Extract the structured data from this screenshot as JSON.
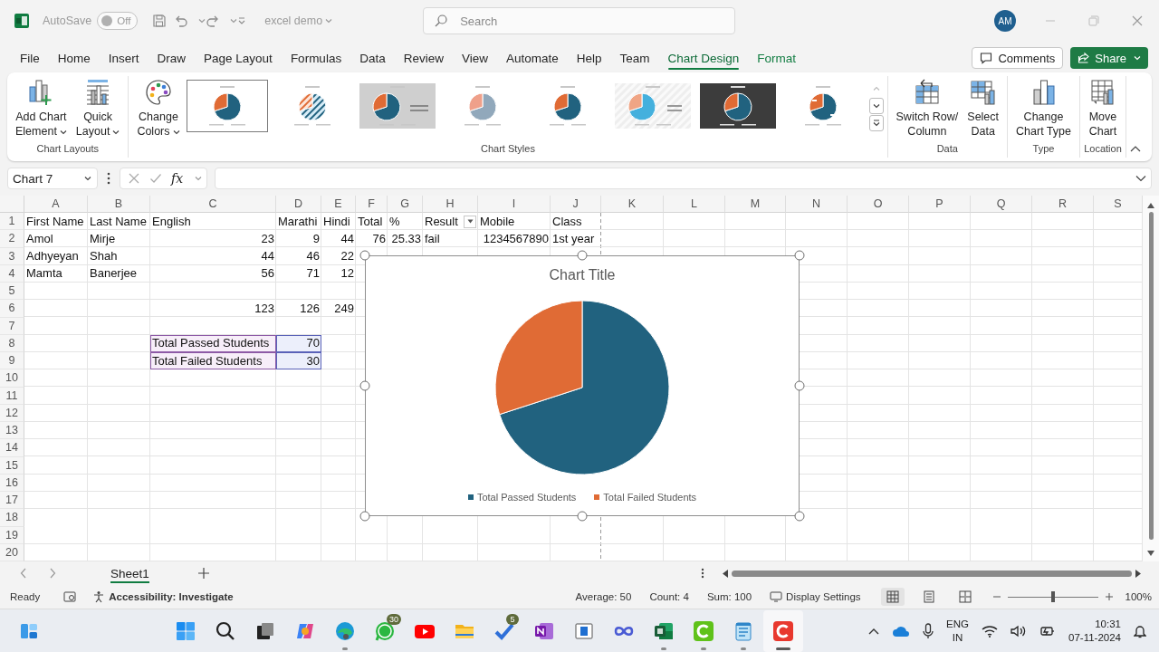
{
  "title_bar": {
    "autosave_label": "AutoSave",
    "autosave": {
      "on": false,
      "label": "Off"
    },
    "document": "excel demo",
    "search": {
      "placeholder": "Search"
    },
    "avatar": "AM"
  },
  "tabs": [
    {
      "label": "File",
      "selected": false,
      "contextual": false
    },
    {
      "label": "Home",
      "selected": false,
      "contextual": false
    },
    {
      "label": "Insert",
      "selected": false,
      "contextual": false
    },
    {
      "label": "Draw",
      "selected": false,
      "contextual": false
    },
    {
      "label": "Page Layout",
      "selected": false,
      "contextual": false
    },
    {
      "label": "Formulas",
      "selected": false,
      "contextual": false
    },
    {
      "label": "Data",
      "selected": false,
      "contextual": false
    },
    {
      "label": "Review",
      "selected": false,
      "contextual": false
    },
    {
      "label": "View",
      "selected": false,
      "contextual": false
    },
    {
      "label": "Automate",
      "selected": false,
      "contextual": false
    },
    {
      "label": "Help",
      "selected": false,
      "contextual": false
    },
    {
      "label": "Team",
      "selected": false,
      "contextual": false
    },
    {
      "label": "Chart Design",
      "selected": true,
      "contextual": true
    },
    {
      "label": "Format",
      "selected": false,
      "contextual": true
    }
  ],
  "comments_button": "Comments",
  "share_button": "Share",
  "ribbon": {
    "groups": [
      {
        "label": "Chart Layouts",
        "buttons": [
          {
            "lines": [
              "Add Chart",
              "Element"
            ],
            "dropdown": true
          },
          {
            "lines": [
              "Quick",
              "Layout"
            ],
            "dropdown": true
          }
        ]
      },
      {
        "label": "Chart Styles",
        "buttons": [
          {
            "lines": [
              "Change",
              "Colors"
            ],
            "dropdown": true
          }
        ],
        "gallery": [
          {
            "kind": "plain",
            "selected": true
          },
          {
            "kind": "hatched",
            "selected": false
          },
          {
            "kind": "shaded",
            "selected": false
          },
          {
            "kind": "soft",
            "selected": false
          },
          {
            "kind": "plain",
            "selected": false
          },
          {
            "kind": "striped",
            "selected": false
          },
          {
            "kind": "dark",
            "selected": false
          },
          {
            "kind": "labeled",
            "selected": false
          }
        ]
      },
      {
        "label": "Data",
        "buttons": [
          {
            "lines": [
              "Switch Row/",
              "Column"
            ],
            "dropdown": false
          },
          {
            "lines": [
              "Select",
              "Data"
            ],
            "dropdown": false
          }
        ]
      },
      {
        "label": "Type",
        "buttons": [
          {
            "lines": [
              "Change",
              "Chart Type"
            ],
            "dropdown": false
          }
        ]
      },
      {
        "label": "Location",
        "buttons": [
          {
            "lines": [
              "Move",
              "Chart"
            ],
            "dropdown": false
          }
        ]
      }
    ]
  },
  "formula_bar": {
    "name_box": "Chart 7",
    "function_label": "fx"
  },
  "sheet": {
    "columns": [
      "A",
      "B",
      "C",
      "D",
      "E",
      "F",
      "G",
      "H",
      "I",
      "J",
      "K",
      "L",
      "M",
      "N",
      "O",
      "P",
      "Q",
      "R",
      "S"
    ],
    "rows": [
      {
        "header": "1",
        "cells": [
          {
            "text": "First Name",
            "kind": "text"
          },
          {
            "text": "Last Name",
            "kind": "text"
          },
          {
            "text": "English",
            "kind": "text"
          },
          {
            "text": "Marathi",
            "kind": "text"
          },
          {
            "text": "Hindi",
            "kind": "text"
          },
          {
            "text": "Total",
            "kind": "text"
          },
          {
            "text": "%",
            "kind": "text"
          },
          {
            "text": "Result",
            "kind": "text",
            "filter": true
          },
          {
            "text": "Mobile",
            "kind": "text"
          },
          {
            "text": "Class",
            "kind": "text"
          }
        ]
      },
      {
        "header": "2",
        "cells": [
          {
            "text": "Amol",
            "kind": "text"
          },
          {
            "text": "Mirje",
            "kind": "text"
          },
          {
            "text": "23",
            "kind": "number"
          },
          {
            "text": "9",
            "kind": "number"
          },
          {
            "text": "44",
            "kind": "number"
          },
          {
            "text": "76",
            "kind": "number"
          },
          {
            "text": "25.33",
            "kind": "number"
          },
          {
            "text": "fail",
            "kind": "text"
          },
          {
            "text": "1234567890",
            "kind": "number"
          },
          {
            "text": "1st year",
            "kind": "text"
          }
        ]
      },
      {
        "header": "3",
        "cells": [
          {
            "text": "Adhyeyan",
            "kind": "text"
          },
          {
            "text": "Shah",
            "kind": "text"
          },
          {
            "text": "44",
            "kind": "number"
          },
          {
            "text": "46",
            "kind": "number"
          },
          {
            "text": "22",
            "kind": "number"
          }
        ]
      },
      {
        "header": "4",
        "cells": [
          {
            "text": "Mamta",
            "kind": "text"
          },
          {
            "text": "Banerjee",
            "kind": "text"
          },
          {
            "text": "56",
            "kind": "number"
          },
          {
            "text": "71",
            "kind": "number"
          },
          {
            "text": "12",
            "kind": "number"
          }
        ]
      },
      {
        "header": "5"
      },
      {
        "header": "6",
        "cells": [
          {
            "kind": "blank"
          },
          {
            "kind": "blank"
          },
          {
            "text": "123",
            "kind": "number"
          },
          {
            "text": "126",
            "kind": "number"
          },
          {
            "text": "249",
            "kind": "number"
          }
        ]
      },
      {
        "header": "7"
      },
      {
        "header": "8",
        "cells": [
          {
            "kind": "blank"
          },
          {
            "kind": "blank"
          },
          {
            "text": "Total Passed Students",
            "kind": "text",
            "highlighted": true
          },
          {
            "text": "70",
            "kind": "number",
            "highlighted": true
          }
        ]
      },
      {
        "header": "9",
        "cells": [
          {
            "kind": "blank"
          },
          {
            "kind": "blank"
          },
          {
            "text": "Total Failed Students",
            "kind": "text",
            "highlighted": true
          },
          {
            "text": "30",
            "kind": "number",
            "highlighted": true
          }
        ]
      },
      {
        "header": "10"
      },
      {
        "header": "11"
      },
      {
        "header": "12"
      },
      {
        "header": "13"
      },
      {
        "header": "14"
      },
      {
        "header": "15"
      },
      {
        "header": "16"
      },
      {
        "header": "17"
      },
      {
        "header": "18"
      },
      {
        "header": "19"
      },
      {
        "header": "20"
      }
    ]
  },
  "chart": {
    "chart_data": {
      "type": "pie",
      "title": "Chart Title",
      "categories": [
        "Total Passed Students",
        "Total Failed Students"
      ],
      "values": [
        70,
        30
      ]
    },
    "legend": [
      {
        "color": "#21627f"
      },
      {
        "color": "#e06b35"
      }
    ]
  },
  "sheet_tabs": [
    {
      "label": "Sheet1",
      "selected": true
    }
  ],
  "status_bar": {
    "ready": "Ready",
    "accessibility": "Accessibility: Investigate",
    "average": "Average: 50",
    "count": "Count: 4",
    "sum": "Sum: 100",
    "display_settings": "Display Settings",
    "views": [
      {
        "selected": true
      },
      {
        "selected": false
      },
      {
        "selected": false
      }
    ],
    "zoom": {
      "level": 0.5,
      "label": "100%"
    }
  },
  "taskbar": {
    "apps": [
      {
        "running": false,
        "active": false
      },
      {
        "running": false,
        "active": false
      },
      {
        "running": false,
        "active": false
      },
      {
        "running": false,
        "active": false
      },
      {
        "running": false,
        "active": false
      },
      {
        "running": true,
        "active": false
      },
      {
        "running": false,
        "active": false,
        "badge": "30"
      },
      {
        "running": false,
        "active": false
      },
      {
        "running": false,
        "active": false
      },
      {
        "running": false,
        "active": false,
        "badge": "5"
      },
      {
        "running": false,
        "active": false
      },
      {
        "running": false,
        "active": false
      },
      {
        "running": false,
        "active": false
      },
      {
        "running": true,
        "active": false
      },
      {
        "running": true,
        "active": false
      },
      {
        "running": true,
        "active": false
      },
      {
        "running": true,
        "active": true
      }
    ],
    "language": "ENG",
    "region": "IN",
    "time": "10:31",
    "date": "07-11-2024"
  }
}
